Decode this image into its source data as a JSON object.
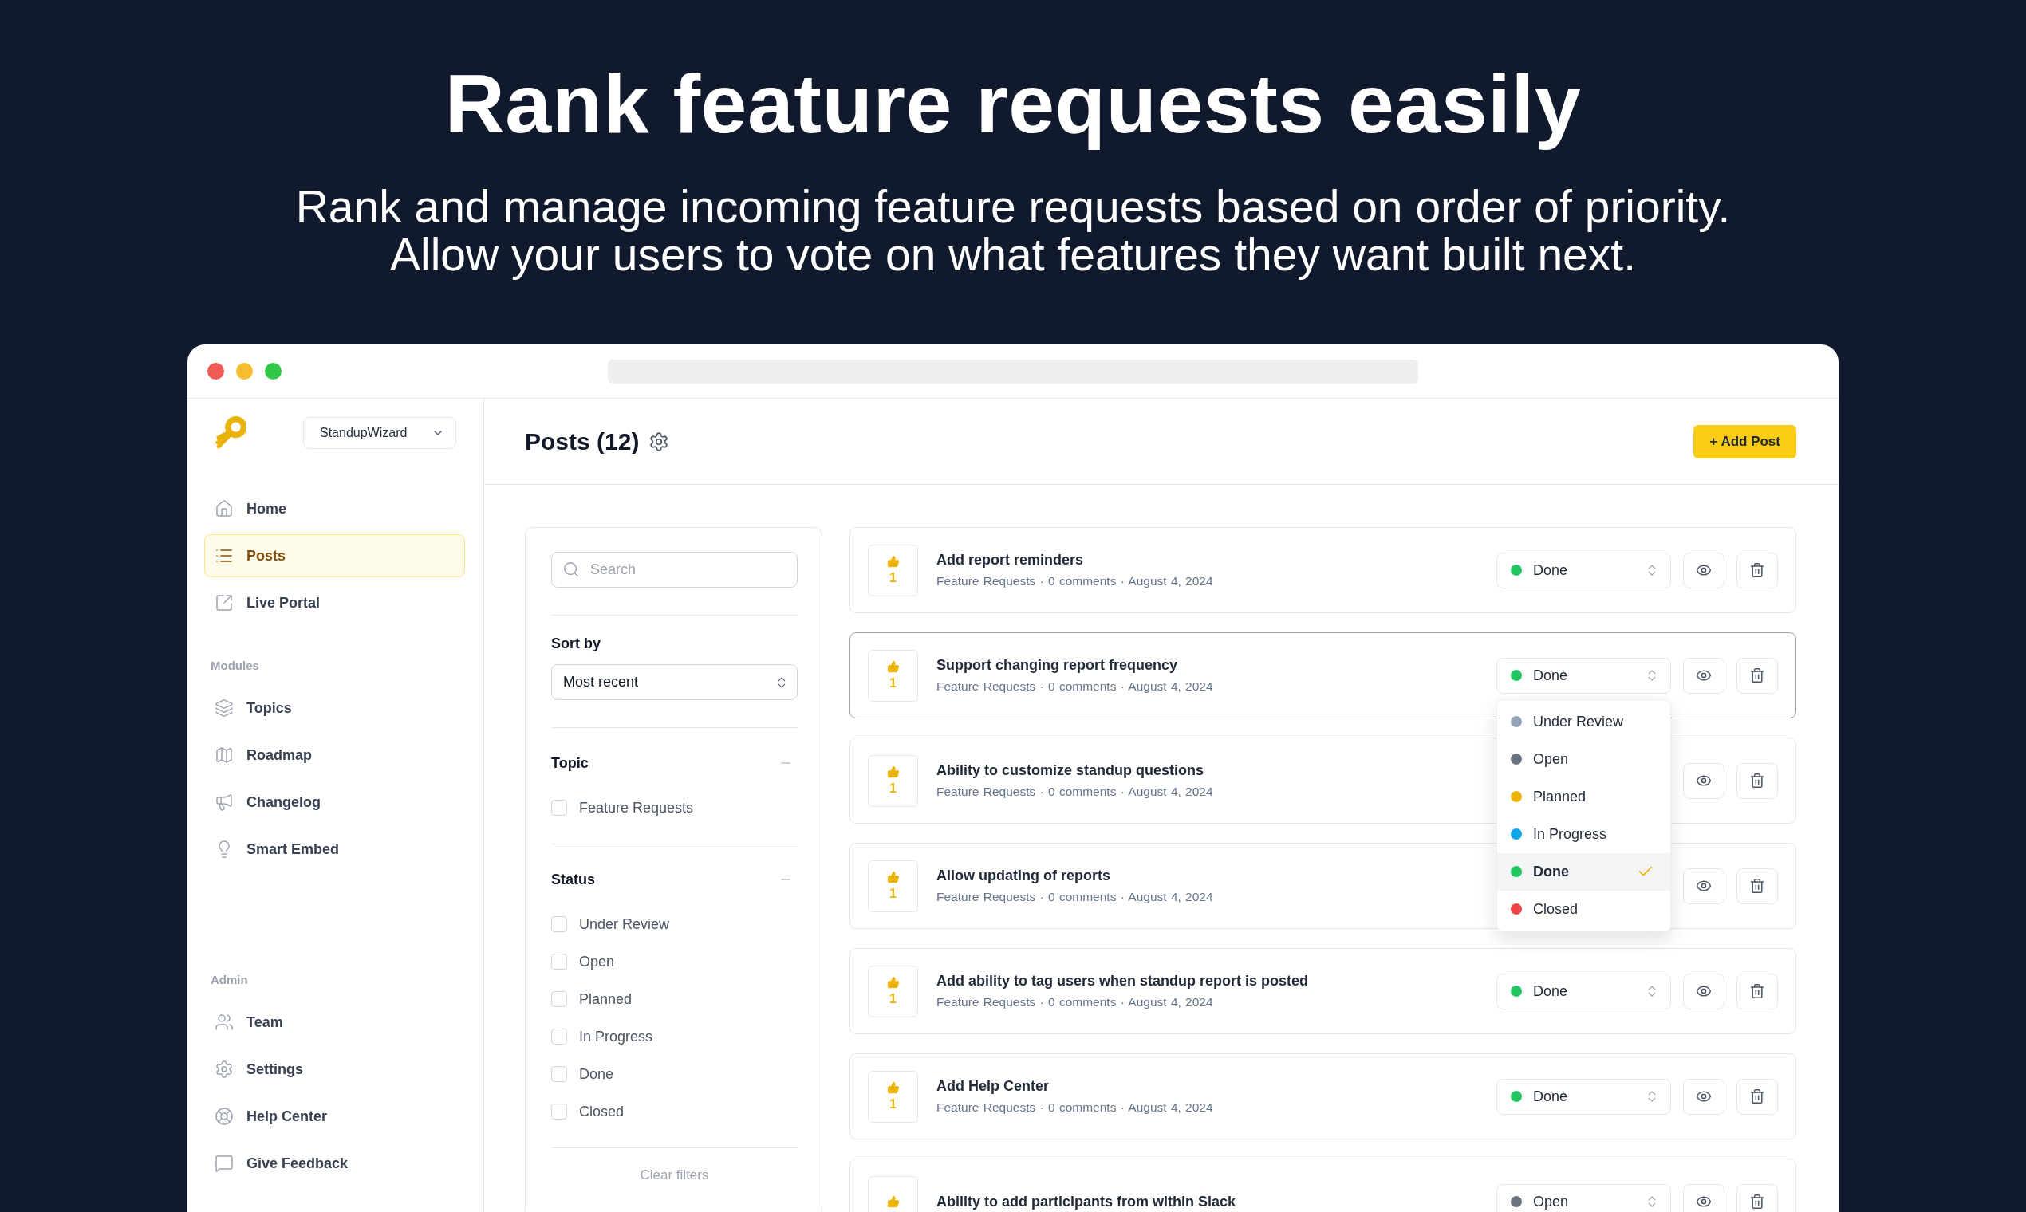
{
  "hero": {
    "title": "Rank feature requests easily",
    "subtitle": [
      "Rank and manage incoming feature requests based on order of priority.",
      "Allow your users to vote on what features they want built next."
    ]
  },
  "sidebar": {
    "workspace": "StandupWizard",
    "sections": [
      {
        "items": [
          {
            "label": "Home",
            "selected": false
          },
          {
            "label": "Posts",
            "selected": true
          },
          {
            "label": "Live Portal",
            "selected": false
          }
        ]
      },
      {
        "heading": "Modules",
        "items": [
          {
            "label": "Topics",
            "selected": false
          },
          {
            "label": "Roadmap",
            "selected": false
          },
          {
            "label": "Changelog",
            "selected": false
          },
          {
            "label": "Smart Embed",
            "selected": false
          }
        ]
      },
      {
        "heading": "Admin",
        "items": [
          {
            "label": "Team",
            "selected": false
          },
          {
            "label": "Settings",
            "selected": false
          },
          {
            "label": "Help Center",
            "selected": false
          },
          {
            "label": "Give Feedback",
            "selected": false
          }
        ]
      }
    ]
  },
  "header": {
    "title": "Posts (12)",
    "add_button": "+ Add Post"
  },
  "filters": {
    "search": {
      "placeholder": "Search"
    },
    "sort": {
      "label": "Sort by",
      "value": "Most recent"
    },
    "groups": [
      {
        "title": "Topic",
        "expanded": true,
        "options": [
          {
            "label": "Feature Requests",
            "checked": false
          }
        ]
      },
      {
        "title": "Status",
        "expanded": true,
        "options": [
          {
            "label": "Under Review",
            "checked": false
          },
          {
            "label": "Open",
            "checked": false
          },
          {
            "label": "Planned",
            "checked": false
          },
          {
            "label": "In Progress",
            "checked": false
          },
          {
            "label": "Done",
            "checked": false
          },
          {
            "label": "Closed",
            "checked": false
          }
        ]
      }
    ],
    "clear_button": "Clear filters"
  },
  "posts": [
    {
      "title": "Add report reminders",
      "votes": "1",
      "meta": "Feature Requests · 0 comments · August 4, 2024",
      "focused": false,
      "status": {
        "label": "Done",
        "color": "#22c55e"
      }
    },
    {
      "title": "Support changing report frequency",
      "votes": "1",
      "meta": "Feature Requests · 0 comments · August 4, 2024",
      "focused": true,
      "status": {
        "label": "Done",
        "color": "#22c55e"
      },
      "status_menu": {
        "options": [
          {
            "label": "Under Review",
            "color": "#94a3b8",
            "selected": false
          },
          {
            "label": "Open",
            "color": "#6b7280",
            "selected": false
          },
          {
            "label": "Planned",
            "color": "#eab308",
            "selected": false
          },
          {
            "label": "In Progress",
            "color": "#0ea5e9",
            "selected": false
          },
          {
            "label": "Done",
            "color": "#22c55e",
            "selected": true
          },
          {
            "label": "Closed",
            "color": "#ef4444",
            "selected": false
          }
        ]
      }
    },
    {
      "title": "Ability to customize standup questions",
      "votes": "1",
      "meta": "Feature Requests · 0 comments · August 4, 2024",
      "focused": false
    },
    {
      "title": "Allow updating of reports",
      "votes": "1",
      "meta": "Feature Requests · 0 comments · August 4, 2024",
      "focused": false
    },
    {
      "title": "Add ability to tag users when standup report is posted",
      "votes": "1",
      "meta": "Feature Requests · 0 comments · August 4, 2024",
      "focused": false,
      "status": {
        "label": "Done",
        "color": "#22c55e"
      }
    },
    {
      "title": "Add Help Center",
      "votes": "1",
      "meta": "Feature Requests · 0 comments · August 4, 2024",
      "focused": false,
      "status": {
        "label": "Done",
        "color": "#22c55e"
      }
    },
    {
      "title": "Ability to add participants from within Slack",
      "focused": false,
      "status": {
        "label": "Open",
        "color": "#6b7280"
      }
    }
  ]
}
